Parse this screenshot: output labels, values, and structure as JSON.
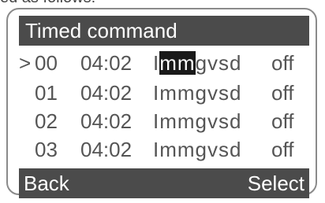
{
  "caption_fragment": "ed as follows:",
  "title": "Timed command",
  "rows": [
    {
      "cursor": ">",
      "index": "00",
      "time": "04:02",
      "days_first": "I",
      "days_selected": "mm",
      "days_rest": "gvsd",
      "state": "off"
    },
    {
      "cursor": "",
      "index": "01",
      "time": "04:02",
      "days_first": "",
      "days_selected": "",
      "days_rest": "Immgvsd",
      "state": "off"
    },
    {
      "cursor": "",
      "index": "02",
      "time": "04:02",
      "days_first": "",
      "days_selected": "",
      "days_rest": "Immgvsd",
      "state": "off"
    },
    {
      "cursor": "",
      "index": "03",
      "time": "04:02",
      "days_first": "",
      "days_selected": "",
      "days_rest": "Immgvsd",
      "state": "off"
    }
  ],
  "softkeys": {
    "left": "Back",
    "right": "Select"
  },
  "colors": {
    "bar_background": "#4b4b4b",
    "bar_text": "#ffffff",
    "row_text": "#555555",
    "highlight": "#1a1a1a"
  }
}
